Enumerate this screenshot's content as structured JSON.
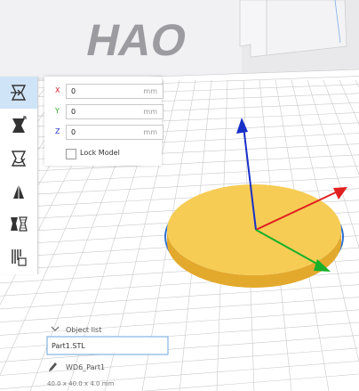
{
  "branding": {
    "backdrop_text": "HAO"
  },
  "toolbar": {
    "tools": [
      {
        "name": "move-tool",
        "icon": "move-icon",
        "active": true
      },
      {
        "name": "scale-tool",
        "icon": "scale-icon",
        "active": false
      },
      {
        "name": "rotate-tool",
        "icon": "rotate-icon",
        "active": false
      },
      {
        "name": "mirror-tool",
        "icon": "mirror-icon",
        "active": false
      },
      {
        "name": "per-model-settings-tool",
        "icon": "per-model-settings-icon",
        "active": false
      },
      {
        "name": "support-blocker-tool",
        "icon": "support-blocker-icon",
        "active": false
      }
    ]
  },
  "move_panel": {
    "x": {
      "label": "X",
      "value": "0",
      "unit": "mm",
      "color": "#d0202c"
    },
    "y": {
      "label": "Y",
      "value": "0",
      "unit": "mm",
      "color": "#2aa52a"
    },
    "z": {
      "label": "Z",
      "value": "0",
      "unit": "mm",
      "color": "#2034c8"
    },
    "lock_label": "Lock Model",
    "lock_checked": false
  },
  "object_list": {
    "header": "Object list",
    "file_name": "Part1.STL",
    "job_name": "WD6_Part1",
    "dimensions": "40.0 x 40.0 x 4.0 mm"
  },
  "colors": {
    "accent": "#3b82c8",
    "model_top": "#f6cc55",
    "model_side": "#e3a92c",
    "selection_outline": "#2f6fd0",
    "axis_x": "#e02020",
    "axis_y": "#18b028",
    "axis_z": "#1830c8"
  }
}
